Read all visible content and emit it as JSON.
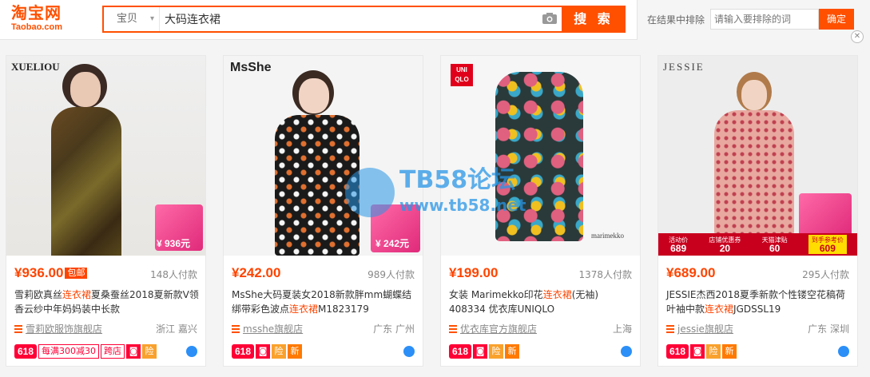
{
  "header": {
    "logo_main": "淘宝网",
    "logo_sub": "Taobao.com",
    "search_category": "宝贝",
    "search_value": "大码连衣裙",
    "search_button": "搜 索",
    "exclude_label": "在结果中排除",
    "exclude_placeholder": "请输入要排除的词",
    "exclude_button": "确定"
  },
  "watermark": {
    "title": "TB58论坛",
    "url": "www.tb58.net"
  },
  "items": [
    {
      "price": "¥936.00",
      "baoyou": "包邮",
      "sales": "148人付款",
      "title_pre": "雪莉欧真丝",
      "title_hl": "连衣裙",
      "title_post": "夏桑蚕丝2018夏新款V领香云纱中年妈妈装中长款",
      "shop": "雪莉欧服饰旗舰店",
      "location": "浙江 嘉兴",
      "badge_618": "618",
      "coupon": "每满300减30",
      "coupon2": "跨店",
      "brand": "XUELIOU",
      "promo_price": "¥ 936元"
    },
    {
      "price": "¥242.00",
      "sales": "989人付款",
      "title_pre": "MsShe大码夏装女2018新款胖mm蝴蝶结绑带彩色波点",
      "title_hl": "连衣裙",
      "title_post": "M1823179",
      "shop": "msshe旗舰店",
      "location": "广东 广州",
      "badge_618": "618",
      "brand": "MsShe",
      "promo_price": "¥ 242元"
    },
    {
      "price": "¥199.00",
      "sales": "1378人付款",
      "title_pre": "女装 Marimekko印花",
      "title_hl": "连衣裙",
      "title_post": "(无袖) 408334 优衣库UNIQLO",
      "shop": "优衣库官方旗舰店",
      "location": "上海",
      "badge_618": "618",
      "brand": "UNI QLO",
      "brand_small": "marimekko"
    },
    {
      "price": "¥689.00",
      "sales": "295人付款",
      "title_pre": "JESSIE杰西2018夏季新款个性镂空花稿荷叶袖中款",
      "title_hl": "连衣裙",
      "title_post": "JGDSSL19",
      "shop": "jessie旗舰店",
      "location": "广东 深圳",
      "badge_618": "618",
      "brand": "JESSIE",
      "promo": [
        "活动价",
        "689",
        "店铺优惠券",
        "20",
        "天猫津贴",
        "60",
        "到手参考价",
        "609"
      ]
    }
  ],
  "colors": {
    "accent": "#ff5000",
    "price": "#ff4400",
    "tmall_red": "#ff0036"
  }
}
